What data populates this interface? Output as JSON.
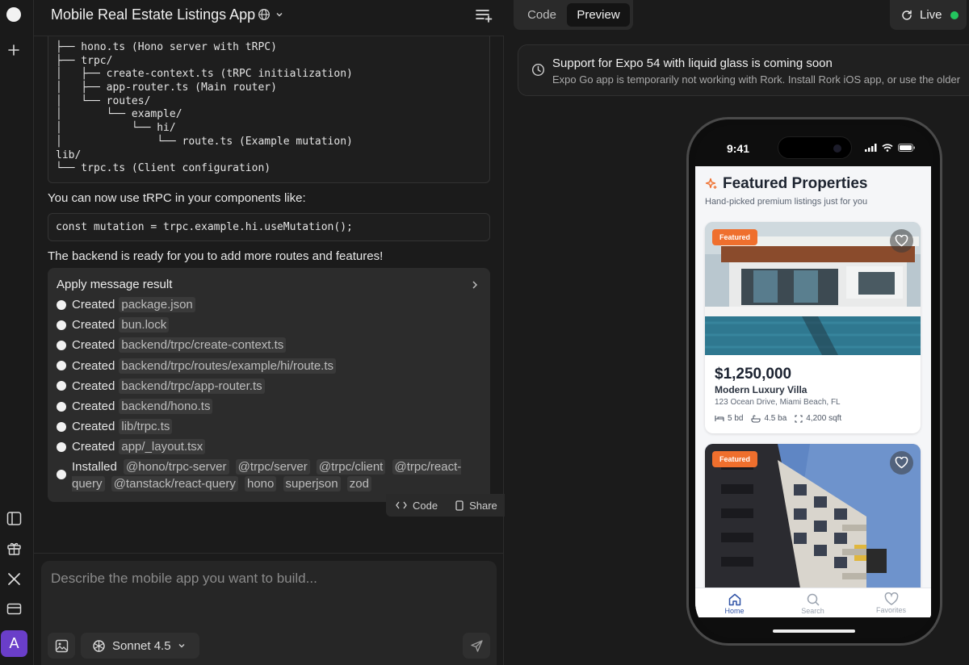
{
  "app": {
    "project_title": "Mobile Real Estate Listings App"
  },
  "rail": {
    "avatar_initial": "A"
  },
  "chat": {
    "code_tree": [
      "├── hono.ts (Hono server with tRPC)",
      "├── trpc/",
      "│   ├── create-context.ts (tRPC initialization)",
      "│   ├── app-router.ts (Main router)",
      "│   └── routes/",
      "│       └── example/",
      "│           └── hi/",
      "│               └── route.ts (Example mutation)",
      "lib/",
      "└── trpc.ts (Client configuration)"
    ],
    "usage_intro": "You can now use tRPC in your components like:",
    "usage_code": "const mutation = trpc.example.hi.useMutation();",
    "closing": "The backend is ready for you to add more routes and features!",
    "apply": {
      "title": "Apply message result",
      "items": [
        {
          "action": "Created",
          "file": "package.json"
        },
        {
          "action": "Created",
          "file": "bun.lock"
        },
        {
          "action": "Created",
          "file": "backend/trpc/create-context.ts"
        },
        {
          "action": "Created",
          "file": "backend/trpc/routes/example/hi/route.ts"
        },
        {
          "action": "Created",
          "file": "backend/trpc/app-router.ts"
        },
        {
          "action": "Created",
          "file": "backend/hono.ts"
        },
        {
          "action": "Created",
          "file": "lib/trpc.ts"
        },
        {
          "action": "Created",
          "file": "app/_layout.tsx"
        }
      ],
      "installed_action": "Installed",
      "packages": [
        "@hono/trpc-server",
        "@trpc/server",
        "@trpc/client",
        "@trpc/react-query",
        "@tanstack/react-query",
        "hono",
        "superjson",
        "zod"
      ]
    },
    "actions": {
      "code": "Code",
      "share": "Share"
    },
    "composer": {
      "placeholder": "Describe the mobile app you want to build...",
      "model": "Sonnet 4.5"
    }
  },
  "preview": {
    "tabs": {
      "code": "Code",
      "preview": "Preview"
    },
    "live_label": "Live",
    "banner": {
      "title": "Support for Expo 54 with liquid glass is coming soon",
      "subtitle": "Expo Go app is temporarily not working with Rork. Install Rork iOS app, or use the older"
    },
    "phone": {
      "time": "9:41",
      "title": "Featured Properties",
      "subtitle": "Hand-picked premium listings just for you",
      "listings": [
        {
          "badge": "Featured",
          "price": "$1,250,000",
          "name": "Modern Luxury Villa",
          "address": "123 Ocean Drive, Miami Beach, FL",
          "beds": "5 bd",
          "baths": "4.5 ba",
          "sqft": "4,200 sqft"
        },
        {
          "badge": "Featured"
        }
      ],
      "tabbar": {
        "home": "Home",
        "search": "Search",
        "favorites": "Favorites"
      }
    }
  },
  "colors": {
    "accent_orange": "#ef6f2d",
    "live_green": "#23c55e",
    "avatar_purple": "#6a3ec9",
    "tab_active_blue": "#2f52a6"
  }
}
